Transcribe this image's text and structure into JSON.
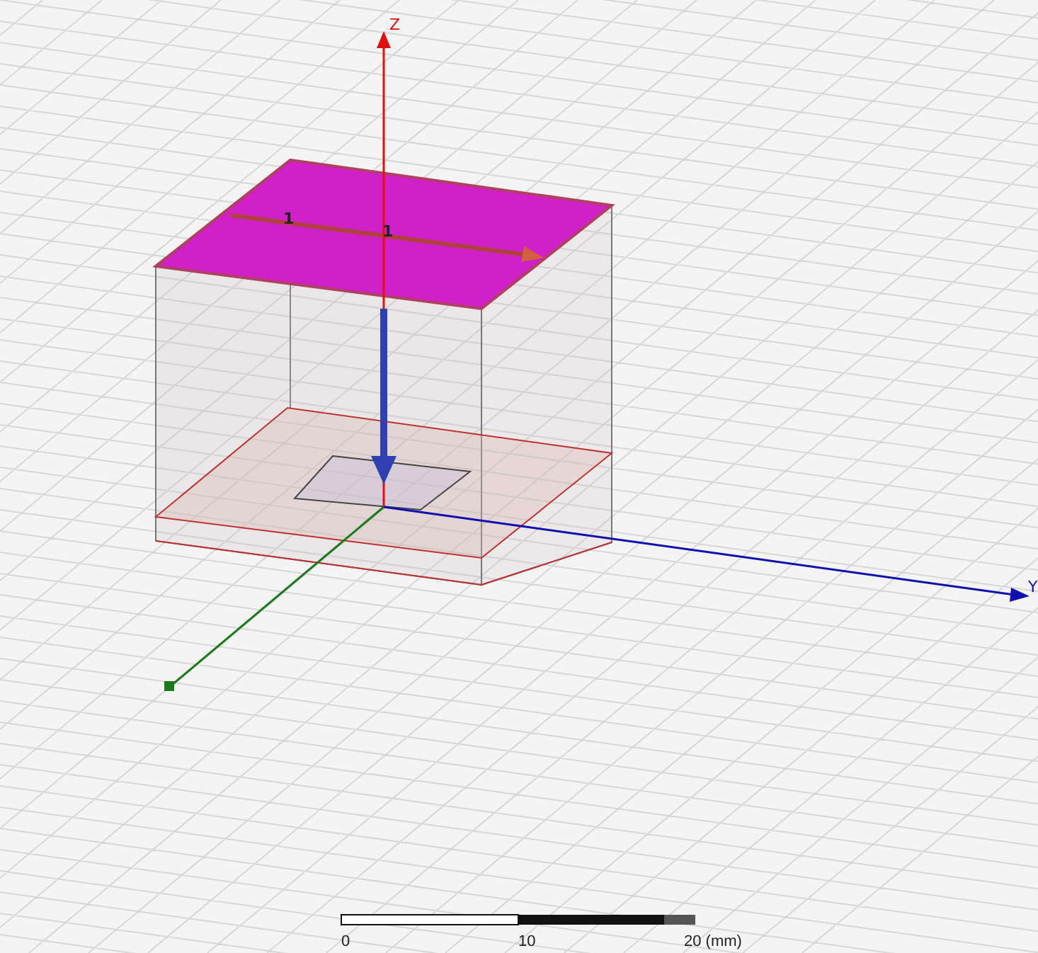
{
  "viewport": {
    "axes": [
      {
        "kind": "z",
        "label": "Z"
      },
      {
        "kind": "y",
        "label": "Y"
      },
      {
        "kind": "x"
      }
    ],
    "port_labels": [
      "1",
      "1"
    ],
    "scale_bar": {
      "ticks": [
        "0",
        "10",
        "20 (mm)"
      ]
    }
  }
}
